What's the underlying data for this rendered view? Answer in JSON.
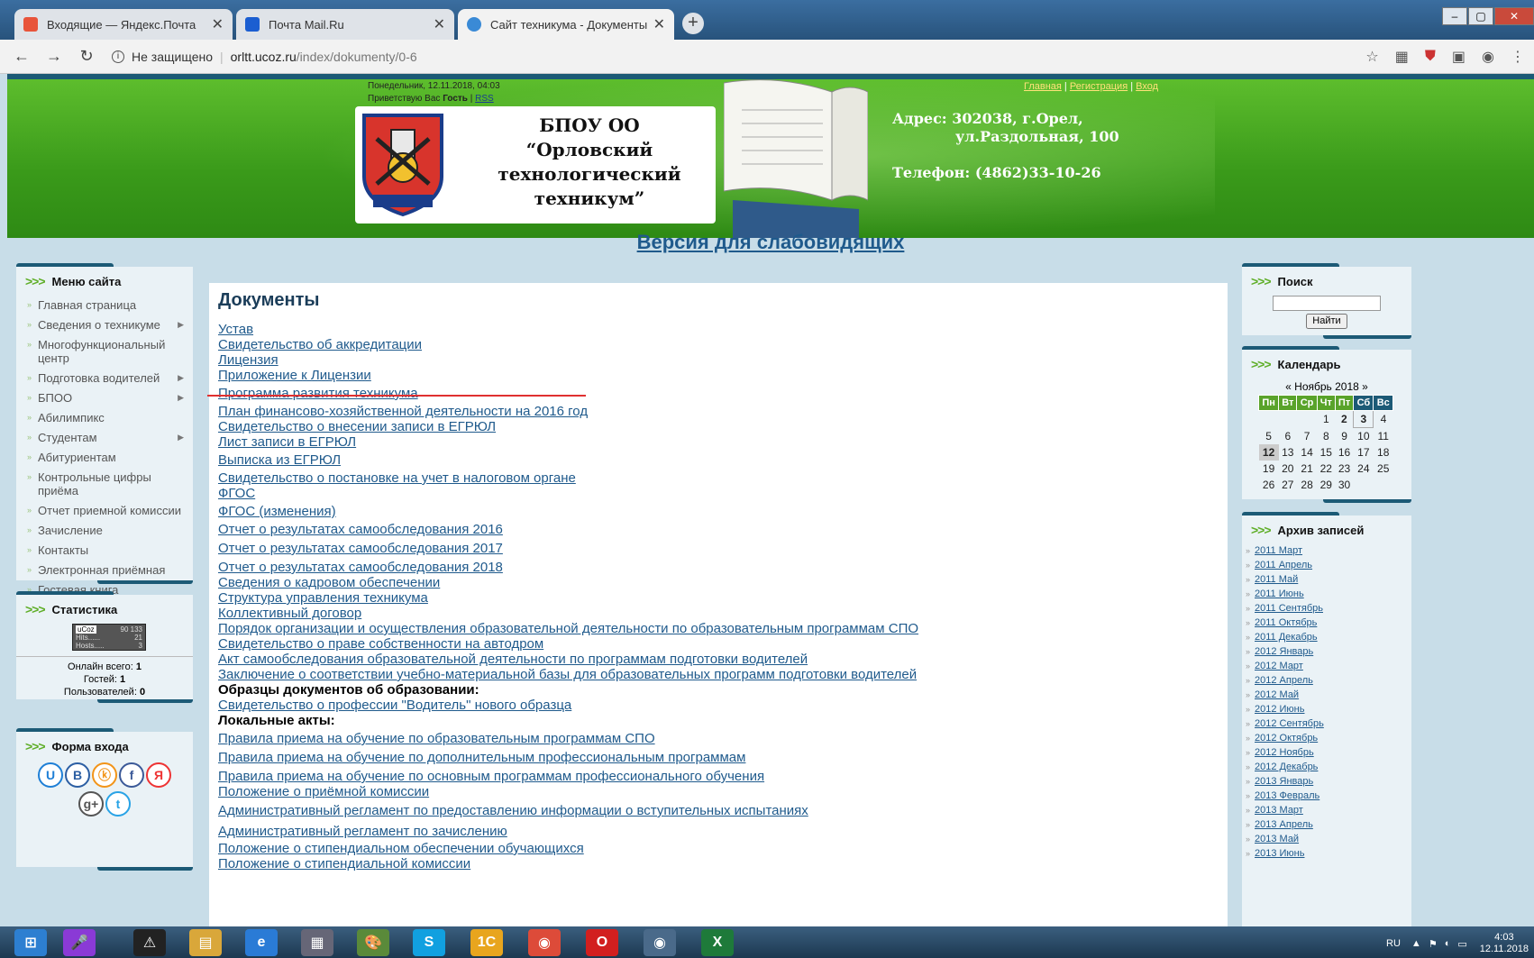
{
  "browser": {
    "tabs": [
      {
        "title": "Входящие — Яндекс.Почта",
        "favicon": "yandex-mail-icon",
        "color": "#e8543a"
      },
      {
        "title": "Почта Mail.Ru",
        "favicon": "mailru-icon",
        "color": "#1b5ed1"
      },
      {
        "title": "Сайт техникума - Документы",
        "favicon": "ucoz-icon",
        "color": "#3a8ad6"
      }
    ],
    "url_security": "Не защищено",
    "url_host": "orltt.ucoz.ru",
    "url_path": "/index/dokumenty/0-6"
  },
  "header": {
    "date": "Понедельник, 12.11.2018, 04:03",
    "greet_prefix": "Приветствую Вас",
    "greet_user": "Гость",
    "rss": "RSS",
    "links": [
      "Главная",
      "Регистрация",
      "Вход"
    ],
    "logo_line1": "БПОУ ОО",
    "logo_line2": "“Орловский",
    "logo_line3": "технологический",
    "logo_line4": "техникум”",
    "address_line1": "Адрес: 302038, г.Орел,",
    "address_line2": "ул.Раздольная, 100",
    "phone": "Телефон: (4862)33-10-26"
  },
  "low_vision_link": "Версия для слабовидящих",
  "menu": {
    "title": "Меню сайта",
    "items": [
      {
        "label": "Главная страница",
        "sub": false
      },
      {
        "label": "Сведения о техникуме",
        "sub": true
      },
      {
        "label": "Многофункциональный центр",
        "sub": false
      },
      {
        "label": "Подготовка водителей",
        "sub": true
      },
      {
        "label": "БПОО",
        "sub": true
      },
      {
        "label": "Абилимпикс",
        "sub": false
      },
      {
        "label": "Студентам",
        "sub": true
      },
      {
        "label": "Абитуриентам",
        "sub": false
      },
      {
        "label": "Контрольные цифры приёма",
        "sub": false
      },
      {
        "label": "Отчет приемной комиссии",
        "sub": false
      },
      {
        "label": "Зачисление",
        "sub": false
      },
      {
        "label": "Контакты",
        "sub": false
      },
      {
        "label": "Электронная приёмная",
        "sub": false
      },
      {
        "label": "Гостевая книга",
        "sub": false
      }
    ]
  },
  "stats": {
    "title": "Статистика",
    "counter_total": "90 133",
    "counter_hits_label": "Hits......",
    "counter_hits": "21",
    "counter_hosts_label": "Hosts.....",
    "counter_hosts": "3",
    "online_label": "Онлайн всего:",
    "online": "1",
    "guests_label": "Гостей:",
    "guests": "1",
    "users_label": "Пользователей:",
    "users": "0"
  },
  "login": {
    "title": "Форма входа",
    "socials": [
      {
        "glyph": "U",
        "name": "ucoz-icon",
        "color": "#1e7fd6"
      },
      {
        "glyph": "B",
        "name": "vk-icon",
        "color": "#2b5ea3"
      },
      {
        "glyph": "ⓚ",
        "name": "odnoklassniki-icon",
        "color": "#f29418"
      },
      {
        "glyph": "f",
        "name": "facebook-icon",
        "color": "#3b5998"
      },
      {
        "glyph": "Я",
        "name": "yandex-icon",
        "color": "#e33"
      },
      {
        "glyph": "g+",
        "name": "google-plus-icon",
        "color": "#555"
      },
      {
        "glyph": "t",
        "name": "twitter-icon",
        "color": "#29a3e6"
      }
    ]
  },
  "content": {
    "title": "Документы",
    "items": [
      {
        "text": "Устав",
        "kind": "link"
      },
      {
        "text": "Свидетельство об аккредитации",
        "kind": "link"
      },
      {
        "text": "Лицензия",
        "kind": "link"
      },
      {
        "text": "Приложение к Лицензии",
        "kind": "link"
      },
      {
        "text": "Программа развития техникума",
        "kind": "link"
      },
      {
        "text": "План финансово-хозяйственной деятельности на 2016 год",
        "kind": "link"
      },
      {
        "text": "Свидетельство о внесении записи в ЕГРЮЛ",
        "kind": "link"
      },
      {
        "text": "Лист записи в ЕГРЮЛ",
        "kind": "link"
      },
      {
        "text": "Выписка из ЕГРЮЛ",
        "kind": "link"
      },
      {
        "text": "Свидетельство о постановке на учет в налоговом органе",
        "kind": "link"
      },
      {
        "text": "ФГОС",
        "kind": "link"
      },
      {
        "text": "ФГОС (изменения)",
        "kind": "link"
      },
      {
        "text": "Отчет о результатах самообследования 2016",
        "kind": "link"
      },
      {
        "text": "Отчет о результатах самообследования 2017",
        "kind": "link"
      },
      {
        "text": "Отчет о результатах самообследования 2018",
        "kind": "link"
      },
      {
        "text": "Сведения о кадровом обеспечении",
        "kind": "link"
      },
      {
        "text": "Структура управления техникума",
        "kind": "link"
      },
      {
        "text": "Коллективный договор",
        "kind": "link"
      },
      {
        "text": "Порядок организации и осуществления образовательной деятельности по образовательным программам СПО",
        "kind": "link"
      },
      {
        "text": "Свидетельство о праве собственности на автодром",
        "kind": "link"
      },
      {
        "text": "Акт самообследования образовательной деятельности по программам подготовки водителей",
        "kind": "link"
      },
      {
        "text": "Заключение о соответствии учебно-материальной базы для образовательных программ подготовки водителей",
        "kind": "link"
      },
      {
        "text": "Образцы документов об образовании:",
        "kind": "header"
      },
      {
        "text": "Свидетельство о профессии \"Водитель\" нового образца",
        "kind": "link"
      },
      {
        "text": "Локальные акты:",
        "kind": "header"
      },
      {
        "text": "Правила приема на обучение по образовательным программам СПО",
        "kind": "link"
      },
      {
        "text": "Правила приема на обучение по дополнительным профессиональным программам",
        "kind": "link"
      },
      {
        "text": "Правила приема на обучение по основным программам профессионального обучения",
        "kind": "link"
      },
      {
        "text": "Положение о приёмной комиссии",
        "kind": "link"
      },
      {
        "text": "Административный регламент по предоставлению информации о вступительных испытаниях",
        "kind": "link"
      },
      {
        "text": "Административный регламент по зачислению",
        "kind": "link"
      },
      {
        "text": "Положение о стипендиальном обеспечении обучающихся",
        "kind": "link"
      },
      {
        "text": "Положение о стипендиальной комиссии",
        "kind": "link"
      }
    ]
  },
  "search": {
    "title": "Поиск",
    "button": "Найти"
  },
  "calendar": {
    "title": "Календарь",
    "prev": "«",
    "next": "»",
    "month": "Ноябрь 2018",
    "days": [
      "Пн",
      "Вт",
      "Ср",
      "Чт",
      "Пт",
      "Сб",
      "Вс"
    ],
    "weeks": [
      [
        "",
        "",
        "",
        "1",
        "2",
        "3",
        "4"
      ],
      [
        "5",
        "6",
        "7",
        "8",
        "9",
        "10",
        "11"
      ],
      [
        "12",
        "13",
        "14",
        "15",
        "16",
        "17",
        "18"
      ],
      [
        "19",
        "20",
        "21",
        "22",
        "23",
        "24",
        "25"
      ],
      [
        "26",
        "27",
        "28",
        "29",
        "30",
        "",
        ""
      ]
    ],
    "today": "12"
  },
  "archive": {
    "title": "Архив записей",
    "items": [
      "2011 Март",
      "2011 Апрель",
      "2011 Май",
      "2011 Июнь",
      "2011 Сентябрь",
      "2011 Октябрь",
      "2011 Декабрь",
      "2012 Январь",
      "2012 Март",
      "2012 Апрель",
      "2012 Май",
      "2012 Июнь",
      "2012 Сентябрь",
      "2012 Октябрь",
      "2012 Ноябрь",
      "2012 Декабрь",
      "2013 Январь",
      "2013 Февраль",
      "2013 Март",
      "2013 Апрель",
      "2013 Май",
      "2013 Июнь"
    ]
  },
  "taskbar": {
    "lang": "RU",
    "time": "4:03",
    "date": "12.11.2018",
    "apps": [
      {
        "name": "start-button-icon",
        "glyph": "⊞",
        "color": "#2d7fd1"
      },
      {
        "name": "voice-assistant-icon",
        "glyph": "🎤",
        "color": "#8a3ad6"
      },
      {
        "name": "launcher-icon",
        "glyph": "⚠",
        "color": "#222"
      },
      {
        "name": "file-explorer-icon",
        "glyph": "▤",
        "color": "#d9a73a"
      },
      {
        "name": "internet-explorer-icon",
        "glyph": "e",
        "color": "#2a7bd6"
      },
      {
        "name": "calculator-icon",
        "glyph": "▦",
        "color": "#667"
      },
      {
        "name": "paint-icon",
        "glyph": "🎨",
        "color": "#5a8a3a"
      },
      {
        "name": "skype-icon",
        "glyph": "S",
        "color": "#11a0e0"
      },
      {
        "name": "1c-icon",
        "glyph": "1С",
        "color": "#e8a51e"
      },
      {
        "name": "chrome-icon",
        "glyph": "◉",
        "color": "#dd4b39"
      },
      {
        "name": "opera-icon",
        "glyph": "O",
        "color": "#d21f1f"
      },
      {
        "name": "chrome-profile-icon",
        "glyph": "◉",
        "color": "#4a6a8a"
      },
      {
        "name": "excel-icon",
        "glyph": "X",
        "color": "#1e7a3a"
      }
    ]
  }
}
